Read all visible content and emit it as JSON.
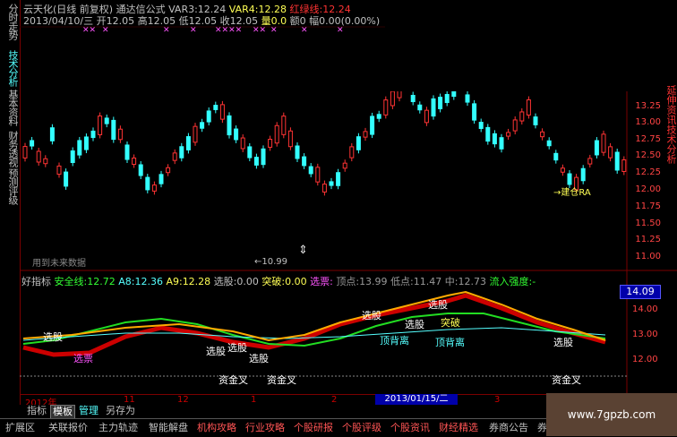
{
  "left_tabs": [
    "分时走势",
    "技术分析",
    "基本资料",
    "财务透视",
    "预测评级"
  ],
  "header": {
    "stock": "云天化(日线 前复权)",
    "formula": "通达信公式",
    "var3_label": "VAR3:",
    "var3_value": "12.24",
    "var4_label": "VAR4:",
    "var4_value": "12.28",
    "redgreen_label": "红绿线:",
    "redgreen_value": "12.24",
    "date": "2013/04/10/三",
    "open_label": "开",
    "open": "12.05",
    "high_label": "高",
    "high": "12.05",
    "low_label": "低",
    "low": "12.05",
    "close_label": "收",
    "close": "12.05",
    "vol_label": "量",
    "vol": "0.0",
    "amt_label": "额",
    "amt": "0",
    "amp_label": "幅",
    "amp": "0.00(0.00%)"
  },
  "main": {
    "future_data_label": "用到未来数据",
    "low_marker": "←10.99",
    "annotation": "→建仓RA",
    "price_axis": [
      "13.25",
      "13.00",
      "12.75",
      "12.50",
      "12.25",
      "12.00",
      "11.75",
      "11.50",
      "11.25",
      "11.00"
    ],
    "right_strip": "延伸资讯技术分析"
  },
  "indicator": {
    "name": "好指标",
    "safe_label": "安全线:",
    "safe": "12.72",
    "a8_label": "A8:",
    "a8": "12.36",
    "a9_label": "A9:",
    "a9": "12.28",
    "pick_label": "选股:",
    "pick": "0.00",
    "break_label": "突破:",
    "break": "0.00",
    "pick2_label": "选票:",
    "pick2": "",
    "top_label": "顶点:",
    "top": "13.99",
    "bottom_label": "低点:",
    "bottom": "11.47",
    "mid_label": "中:",
    "mid": "12.73",
    "flow_label": "流入强度:",
    "flow": "-",
    "current_price": "14.09",
    "axis": [
      "14.00",
      "13.00",
      "12.00"
    ],
    "labels": {
      "pick": "选股",
      "select_ticket": "选票",
      "breakout": "突破",
      "top_back": "顶背离",
      "safe_fork": "资金叉"
    }
  },
  "dates": {
    "left": "2012年",
    "ticks": [
      "11",
      "12",
      "1",
      "2",
      "3"
    ],
    "highlight": "2013/01/15/二"
  },
  "tabs": [
    "指标",
    "模板",
    "管理",
    "另存为"
  ],
  "bottom_bar": [
    "扩展区",
    "关联报价",
    "主力轨迹",
    "智能解盘",
    "机构攻略",
    "行业攻略",
    "个股研报",
    "个股评级",
    "个股资讯",
    "财经精选",
    "券商公告",
    "券"
  ],
  "watermark": "www.7gpzb.com"
}
